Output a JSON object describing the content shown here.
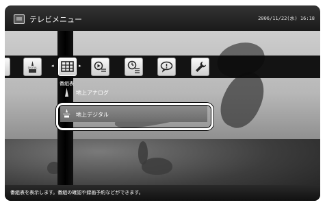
{
  "header": {
    "title": "テレビメニュー",
    "datetime": "2006/11/22(水) 16:18"
  },
  "toolbar": {
    "selected_label": "番組表",
    "icons": [
      "digital-broadcast-icon",
      "program-guide-icon",
      "recorded-video-icon",
      "timer-recording-icon",
      "info-icon",
      "settings-wrench-icon"
    ]
  },
  "list": {
    "items": [
      {
        "label": "地上アナログ",
        "icon": "antenna-icon"
      },
      {
        "label": "地上デジタル",
        "icon": "digital-broadcast-icon"
      }
    ],
    "selected_index": 1
  },
  "status": {
    "text": "番組表を表示します。番組の確認や録画予約などができます。"
  },
  "colors": {
    "header_bg": "#1a1a1a",
    "highlight_border": "#ffffff",
    "selected_row": "#7a7a7a"
  }
}
